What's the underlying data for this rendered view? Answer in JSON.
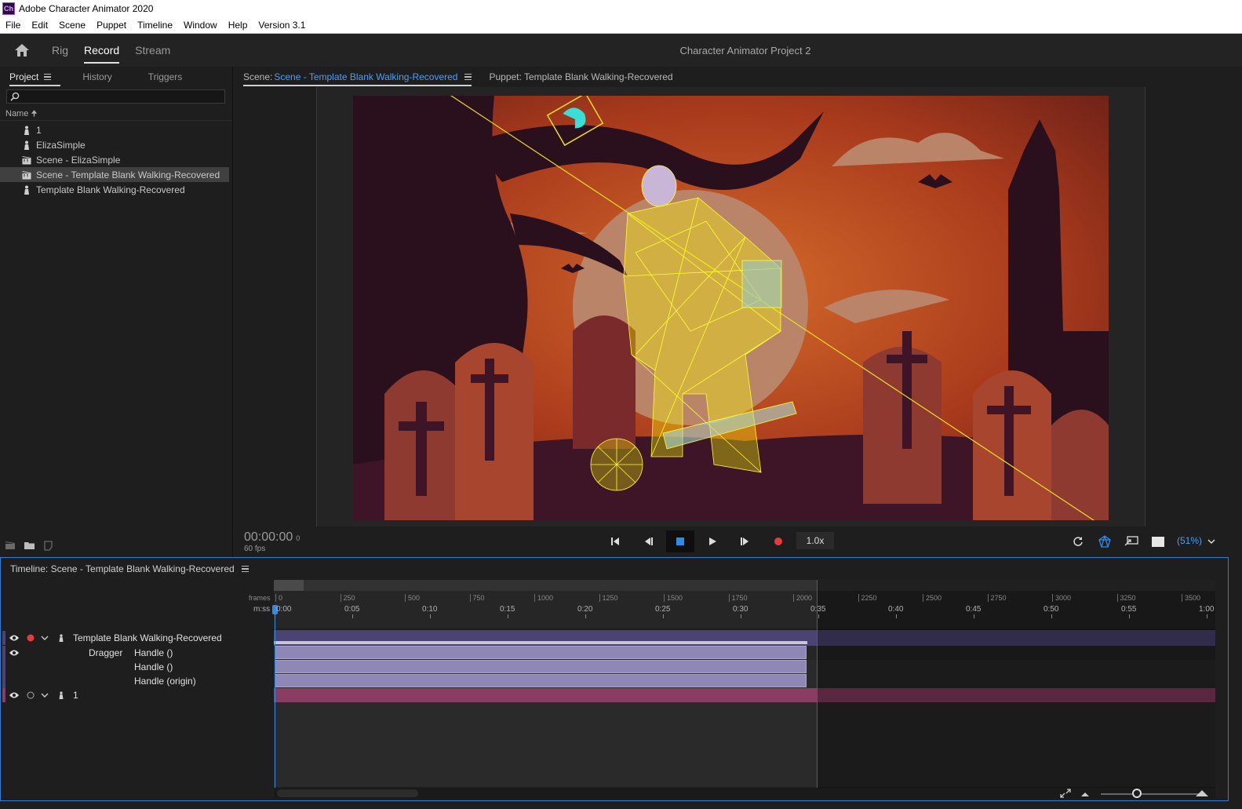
{
  "window": {
    "title": "Adobe Character Animator 2020",
    "icon_label": "Ch"
  },
  "menu": [
    "File",
    "Edit",
    "Scene",
    "Puppet",
    "Timeline",
    "Window",
    "Help",
    "Version 3.1"
  ],
  "workspace": {
    "tabs": [
      "Rig",
      "Record",
      "Stream"
    ],
    "active_tab": "Record",
    "project_title": "Character Animator Project 2"
  },
  "project_panel": {
    "tabs": [
      "Project",
      "History",
      "Triggers"
    ],
    "active_tab": "Project",
    "search_placeholder": "",
    "column_header": "Name",
    "items": [
      {
        "label": "1",
        "type": "puppet-icon",
        "selected": false
      },
      {
        "label": "ElizaSimple",
        "type": "puppet-icon",
        "selected": false
      },
      {
        "label": "Scene - ElizaSimple",
        "type": "scene-icon",
        "selected": false
      },
      {
        "label": "Scene - Template Blank Walking-Recovered",
        "type": "scene-icon",
        "selected": true
      },
      {
        "label": "Template Blank Walking-Recovered",
        "type": "puppet-icon",
        "selected": false
      }
    ]
  },
  "scene_panel": {
    "scene_prefix": "Scene:",
    "scene_name": "Scene - Template Blank Walking-Recovered",
    "puppet_label": "Puppet: Template Blank Walking-Recovered",
    "timecode": "00:00:00",
    "timecode_frame": "0",
    "fps": "60 fps",
    "speed": "1.0x",
    "zoom": "(51%)"
  },
  "timeline": {
    "title": "Timeline: Scene - Template Blank Walking-Recovered",
    "frames_label": "frames",
    "time_label": "m:ss",
    "frame_ticks": [
      "0",
      "250",
      "500",
      "750",
      "1000",
      "1250",
      "1500",
      "1750",
      "2000",
      "2250",
      "2500",
      "2750",
      "3000",
      "3250",
      "3500"
    ],
    "time_ticks": [
      "0:00",
      "0:05",
      "0:10",
      "0:15",
      "0:20",
      "0:25",
      "0:30",
      "0:35",
      "0:40",
      "0:45",
      "0:50",
      "0:55",
      "1:00"
    ],
    "tracks": {
      "puppet_main": "Template Blank Walking-Recovered",
      "behavior": "Dragger",
      "handles": [
        "Handle ()",
        "Handle ()",
        "Handle (origin)"
      ],
      "puppet_second": "1"
    }
  },
  "colors": {
    "accent": "#2f8ae8",
    "record": "#e83a3a",
    "mesh": "#ffff33",
    "track_puppet": "#4b4472",
    "track_handle": "#8f87b5",
    "track_second": "#8a3d63"
  }
}
